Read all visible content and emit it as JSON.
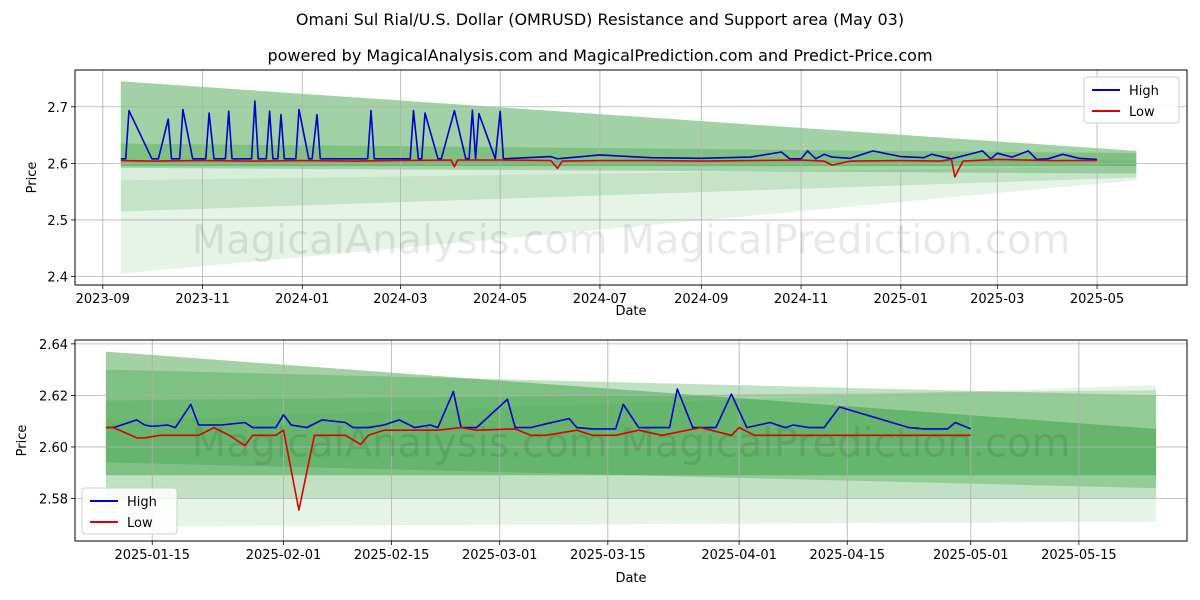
{
  "title": "Omani Sul Rial/U.S. Dollar (OMRUSD) Resistance and Support area (May 03)",
  "subtitle": "powered by MagicalAnalysis.com and MagicalPrediction.com and Predict-Price.com",
  "watermark": "MagicalAnalysis.com   MagicalPrediction.com",
  "colors": {
    "high": "#0000cc",
    "low": "#dd0000",
    "band": "#2e9a36",
    "grid": "#b0b0b0"
  },
  "chart_data": [
    {
      "type": "line",
      "xlabel": "Date",
      "ylabel": "Price",
      "xlim": [
        "2023-08-15",
        "2025-06-25"
      ],
      "ylim": [
        2.385,
        2.765
      ],
      "x_ticks": [
        "2023-09",
        "2023-11",
        "2024-01",
        "2024-03",
        "2024-05",
        "2024-07",
        "2024-09",
        "2024-11",
        "2025-01",
        "2025-03",
        "2025-05"
      ],
      "y_ticks": [
        2.4,
        2.5,
        2.6,
        2.7
      ],
      "grid": true,
      "legend": "top-right",
      "legend_items": [
        "High",
        "Low"
      ],
      "bands": [
        {
          "x": [
            "2023-09-12",
            "2025-05-25"
          ],
          "upper": [
            2.745,
            2.622
          ],
          "lower": [
            2.595,
            2.595
          ],
          "alpha": 0.45
        },
        {
          "x": [
            "2023-09-12",
            "2025-05-25"
          ],
          "upper": [
            2.635,
            2.618
          ],
          "lower": [
            2.592,
            2.582
          ],
          "alpha": 0.3
        },
        {
          "x": [
            "2023-09-12",
            "2025-05-25"
          ],
          "upper": [
            2.605,
            2.605
          ],
          "lower": [
            2.515,
            2.575
          ],
          "alpha": 0.18
        },
        {
          "x": [
            "2023-09-12",
            "2025-05-25"
          ],
          "upper": [
            2.57,
            2.595
          ],
          "lower": [
            2.405,
            2.57
          ],
          "alpha": 0.12
        }
      ],
      "series": [
        {
          "name": "High",
          "x": [
            "2023-09-12",
            "2023-09-15",
            "2023-09-17",
            "2023-10-01",
            "2023-10-03",
            "2023-10-05",
            "2023-10-11",
            "2023-10-13",
            "2023-10-18",
            "2023-10-20",
            "2023-10-26",
            "2023-11-03",
            "2023-11-05",
            "2023-11-08",
            "2023-11-10",
            "2023-11-15",
            "2023-11-17",
            "2023-11-19",
            "2023-12-01",
            "2023-12-03",
            "2023-12-05",
            "2023-12-10",
            "2023-12-12",
            "2023-12-14",
            "2023-12-17",
            "2023-12-19",
            "2023-12-21",
            "2023-12-28",
            "2023-12-30",
            "2024-01-05",
            "2024-01-07",
            "2024-01-10",
            "2024-01-12",
            "2024-01-14",
            "2024-02-10",
            "2024-02-12",
            "2024-02-14",
            "2024-03-05",
            "2024-03-07",
            "2024-03-09",
            "2024-03-12",
            "2024-03-14",
            "2024-03-16",
            "2024-03-24",
            "2024-03-26",
            "2024-04-03",
            "2024-04-10",
            "2024-04-12",
            "2024-04-14",
            "2024-04-16",
            "2024-04-18",
            "2024-04-28",
            "2024-05-01",
            "2024-05-03",
            "2024-06-01",
            "2024-06-05",
            "2024-07-01",
            "2024-08-01",
            "2024-09-01",
            "2024-10-01",
            "2024-10-20",
            "2024-10-25",
            "2024-11-01",
            "2024-11-05",
            "2024-11-10",
            "2024-11-15",
            "2024-11-20",
            "2024-12-01",
            "2024-12-15",
            "2025-01-01",
            "2025-01-15",
            "2025-01-20",
            "2025-02-01",
            "2025-02-20",
            "2025-02-25",
            "2025-03-01",
            "2025-03-10",
            "2025-03-20",
            "2025-03-25",
            "2025-04-01",
            "2025-04-10",
            "2025-04-20",
            "2025-05-01"
          ],
          "values": [
            2.608,
            2.608,
            2.693,
            2.608,
            2.608,
            2.608,
            2.678,
            2.608,
            2.608,
            2.695,
            2.608,
            2.608,
            2.689,
            2.608,
            2.608,
            2.608,
            2.692,
            2.608,
            2.608,
            2.71,
            2.608,
            2.608,
            2.692,
            2.608,
            2.608,
            2.686,
            2.608,
            2.608,
            2.695,
            2.608,
            2.608,
            2.686,
            2.608,
            2.608,
            2.608,
            2.693,
            2.608,
            2.608,
            2.608,
            2.693,
            2.608,
            2.608,
            2.689,
            2.608,
            2.608,
            2.693,
            2.608,
            2.608,
            2.694,
            2.608,
            2.688,
            2.608,
            2.692,
            2.608,
            2.612,
            2.608,
            2.615,
            2.61,
            2.609,
            2.611,
            2.62,
            2.608,
            2.608,
            2.622,
            2.608,
            2.616,
            2.611,
            2.609,
            2.622,
            2.612,
            2.61,
            2.616,
            2.608,
            2.622,
            2.608,
            2.618,
            2.611,
            2.622,
            2.607,
            2.608,
            2.616,
            2.609,
            2.607
          ]
        },
        {
          "name": "Low",
          "x": [
            "2023-09-12",
            "2023-10-01",
            "2023-11-01",
            "2023-12-01",
            "2024-01-01",
            "2024-02-01",
            "2024-03-01",
            "2024-04-01",
            "2024-04-03",
            "2024-04-05",
            "2024-05-01",
            "2024-06-01",
            "2024-06-05",
            "2024-06-08",
            "2024-07-01",
            "2024-08-01",
            "2024-09-01",
            "2024-10-01",
            "2024-11-01",
            "2024-11-15",
            "2024-11-20",
            "2024-12-01",
            "2025-01-01",
            "2025-01-25",
            "2025-02-01",
            "2025-02-03",
            "2025-02-08",
            "2025-03-01",
            "2025-04-01",
            "2025-05-01"
          ],
          "values": [
            2.605,
            2.604,
            2.605,
            2.604,
            2.605,
            2.604,
            2.605,
            2.606,
            2.594,
            2.606,
            2.606,
            2.605,
            2.591,
            2.604,
            2.605,
            2.605,
            2.604,
            2.605,
            2.606,
            2.604,
            2.597,
            2.604,
            2.605,
            2.604,
            2.607,
            2.576,
            2.604,
            2.607,
            2.605,
            2.605
          ]
        }
      ]
    },
    {
      "type": "line",
      "xlabel": "Date",
      "ylabel": "Price",
      "xlim": [
        "2025-01-05",
        "2025-05-29"
      ],
      "ylim": [
        2.5635,
        2.6415
      ],
      "x_ticks": [
        "2025-01-15",
        "2025-02-01",
        "2025-02-15",
        "2025-03-01",
        "2025-03-15",
        "2025-04-01",
        "2025-04-15",
        "2025-05-01",
        "2025-05-15"
      ],
      "y_ticks": [
        2.58,
        2.6,
        2.62,
        2.64
      ],
      "grid": true,
      "legend": "bottom-left",
      "legend_items": [
        "High",
        "Low"
      ],
      "bands": [
        {
          "x": [
            "2025-01-09",
            "2025-05-25"
          ],
          "upper": [
            2.637,
            2.607
          ],
          "lower": [
            2.589,
            2.589
          ],
          "alpha": 0.45
        },
        {
          "x": [
            "2025-01-09",
            "2025-05-25"
          ],
          "upper": [
            2.63,
            2.62
          ],
          "lower": [
            2.594,
            2.584
          ],
          "alpha": 0.3
        },
        {
          "x": [
            "2025-01-09",
            "2025-05-25"
          ],
          "upper": [
            2.618,
            2.622
          ],
          "lower": [
            2.58,
            2.58
          ],
          "alpha": 0.2
        },
        {
          "x": [
            "2025-01-09",
            "2025-05-25"
          ],
          "upper": [
            2.61,
            2.624
          ],
          "lower": [
            2.569,
            2.571
          ],
          "alpha": 0.12
        }
      ],
      "series": [
        {
          "name": "High",
          "x": [
            "2025-01-09",
            "2025-01-10",
            "2025-01-13",
            "2025-01-14",
            "2025-01-15",
            "2025-01-17",
            "2025-01-18",
            "2025-01-20",
            "2025-01-21",
            "2025-01-23",
            "2025-01-24",
            "2025-01-27",
            "2025-01-28",
            "2025-01-31",
            "2025-02-01",
            "2025-02-02",
            "2025-02-04",
            "2025-02-06",
            "2025-02-09",
            "2025-02-10",
            "2025-02-12",
            "2025-02-14",
            "2025-02-16",
            "2025-02-18",
            "2025-02-20",
            "2025-02-21",
            "2025-02-23",
            "2025-02-24",
            "2025-02-26",
            "2025-03-02",
            "2025-03-03",
            "2025-03-05",
            "2025-03-07",
            "2025-03-10",
            "2025-03-11",
            "2025-03-13",
            "2025-03-16",
            "2025-03-17",
            "2025-03-19",
            "2025-03-23",
            "2025-03-24",
            "2025-03-26",
            "2025-03-29",
            "2025-03-31",
            "2025-04-02",
            "2025-04-05",
            "2025-04-07",
            "2025-04-08",
            "2025-04-10",
            "2025-04-12",
            "2025-04-14",
            "2025-04-23",
            "2025-04-25",
            "2025-04-28",
            "2025-04-29",
            "2025-05-01"
          ],
          "values": [
            2.6075,
            2.6075,
            2.6105,
            2.6085,
            2.608,
            2.6085,
            2.6075,
            2.6165,
            2.6085,
            2.6085,
            2.6085,
            2.6095,
            2.6075,
            2.6075,
            2.6125,
            2.6085,
            2.6075,
            2.6105,
            2.6095,
            2.6075,
            2.6075,
            2.6085,
            2.6105,
            2.6075,
            2.6085,
            2.6075,
            2.6215,
            2.6075,
            2.6075,
            2.6185,
            2.6075,
            2.6075,
            2.609,
            2.611,
            2.6075,
            2.607,
            2.607,
            2.6165,
            2.6075,
            2.6075,
            2.6225,
            2.6075,
            2.6075,
            2.6205,
            2.6075,
            2.6095,
            2.6075,
            2.6085,
            2.6075,
            2.6075,
            2.6155,
            2.6075,
            2.607,
            2.607,
            2.6095,
            2.607
          ]
        },
        {
          "name": "Low",
          "x": [
            "2025-01-09",
            "2025-01-10",
            "2025-01-13",
            "2025-01-14",
            "2025-01-16",
            "2025-01-18",
            "2025-01-21",
            "2025-01-23",
            "2025-01-25",
            "2025-01-27",
            "2025-01-28",
            "2025-01-31",
            "2025-02-01",
            "2025-02-03",
            "2025-02-05",
            "2025-02-09",
            "2025-02-11",
            "2025-02-12",
            "2025-02-14",
            "2025-02-17",
            "2025-02-21",
            "2025-02-24",
            "2025-02-26",
            "2025-03-03",
            "2025-03-05",
            "2025-03-07",
            "2025-03-11",
            "2025-03-13",
            "2025-03-16",
            "2025-03-19",
            "2025-03-22",
            "2025-03-27",
            "2025-03-31",
            "2025-04-01",
            "2025-04-03",
            "2025-04-14",
            "2025-04-16",
            "2025-05-01"
          ],
          "values": [
            2.6075,
            2.6075,
            2.6035,
            2.6035,
            2.6045,
            2.6045,
            2.6045,
            2.6075,
            2.6045,
            2.6005,
            2.6045,
            2.6045,
            2.6065,
            2.5755,
            2.6045,
            2.6045,
            2.601,
            2.6045,
            2.6065,
            2.6065,
            2.6065,
            2.6075,
            2.6065,
            2.607,
            2.6045,
            2.6045,
            2.6065,
            2.6045,
            2.6045,
            2.6065,
            2.6045,
            2.6075,
            2.6045,
            2.6075,
            2.6045,
            2.6045,
            2.6045,
            2.6045
          ]
        }
      ]
    }
  ]
}
